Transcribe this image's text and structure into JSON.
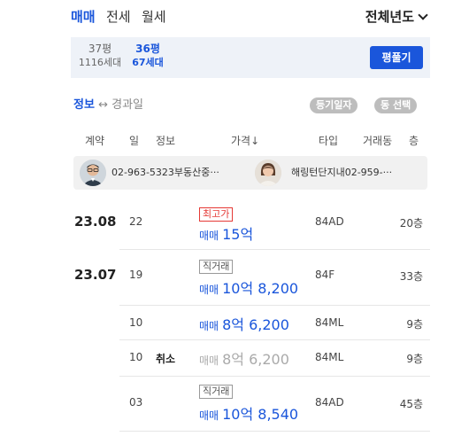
{
  "tabs": [
    {
      "label": "매매",
      "active": true
    },
    {
      "label": "전세",
      "active": false
    },
    {
      "label": "월세",
      "active": false
    }
  ],
  "year_select": "전체년도",
  "sizes": [
    {
      "pyeong": "37평",
      "households": "1116세대",
      "selected": false
    },
    {
      "pyeong": "36평",
      "households": "67세대",
      "selected": true
    }
  ],
  "pyeong_button": "평풀기",
  "info": {
    "primary": "정보",
    "arrow": "↔",
    "secondary": "경과일",
    "pill_registry": "등기일자",
    "pill_dong": "동 선택"
  },
  "columns": [
    "계약",
    "일",
    "정보",
    "가격↓",
    "타입",
    "거래동",
    "층"
  ],
  "agents": [
    {
      "text": "02-963-5323부동산중···"
    },
    {
      "text": "해링턴단지내02-959-···"
    }
  ],
  "rows": [
    {
      "ym": "23.08",
      "day": "22",
      "status": "",
      "tag": "최고가",
      "tag_kind": "high",
      "deal": "매매",
      "price": "15억",
      "type": "84AD",
      "floor": "20층",
      "cancelled": false
    },
    {
      "ym": "23.07",
      "day": "19",
      "status": "",
      "tag": "직거래",
      "tag_kind": "direct",
      "deal": "매매",
      "price": "10억 8,200",
      "type": "84F",
      "floor": "33층",
      "cancelled": false
    },
    {
      "ym": "",
      "day": "10",
      "status": "",
      "tag": "",
      "tag_kind": "",
      "deal": "매매",
      "price": "8억 6,200",
      "type": "84ML",
      "floor": "9층",
      "cancelled": false
    },
    {
      "ym": "",
      "day": "10",
      "status": "취소",
      "tag": "",
      "tag_kind": "",
      "deal": "매매",
      "price": "8억 6,200",
      "type": "84ML",
      "floor": "9층",
      "cancelled": true
    },
    {
      "ym": "",
      "day": "03",
      "status": "",
      "tag": "직거래",
      "tag_kind": "direct",
      "deal": "매매",
      "price": "10억 8,540",
      "type": "84AD",
      "floor": "45층",
      "cancelled": false
    }
  ],
  "colors": {
    "accent": "#1a56db",
    "high": "#e53935",
    "cancel": "#aaaaaa"
  }
}
